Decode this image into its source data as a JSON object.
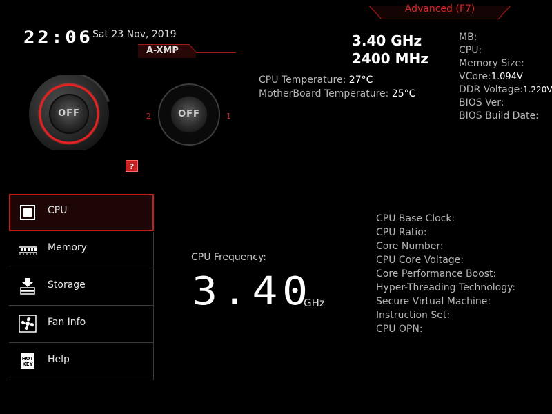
{
  "header": {
    "advanced_label": "Advanced (F7)",
    "clock": "22:06",
    "date": "Sat  23 Nov, 2019",
    "axmp_label": "A-XMP"
  },
  "knobs": {
    "game_boost_state": "OFF",
    "axmp_state": "OFF",
    "axmp_left_number": "2",
    "axmp_right_number": "1",
    "help_label": "?"
  },
  "summary": {
    "cpu_speed": "3.40 GHz",
    "memory_speed": "2400 MHz",
    "cpu_temperature_label": "CPU Temperature:",
    "cpu_temperature_value": "27°C",
    "mb_temperature_label": "MotherBoard Temperature:",
    "mb_temperature_value": "25°C"
  },
  "system_info": {
    "mb_label": "MB:",
    "cpu_label": "CPU:",
    "memory_size_label": "Memory Size:",
    "vcore_label": "VCore:",
    "vcore_value": "1.094V",
    "ddr_voltage_label": "DDR Voltage:",
    "ddr_voltage_value": "1.220V",
    "bios_ver_label": "BIOS Ver:",
    "bios_build_date_label": "BIOS Build Date:"
  },
  "sidebar": {
    "items": [
      {
        "label": "CPU",
        "icon": "cpu-icon",
        "active": true
      },
      {
        "label": "Memory",
        "icon": "memory-icon",
        "active": false
      },
      {
        "label": "Storage",
        "icon": "storage-icon",
        "active": false
      },
      {
        "label": "Fan Info",
        "icon": "fan-icon",
        "active": false
      },
      {
        "label": "Help",
        "icon": "hotkey-icon",
        "active": false
      }
    ]
  },
  "main": {
    "frequency_label": "CPU Frequency:",
    "frequency_value": "3.40",
    "frequency_unit": "GHz",
    "spec_labels": [
      "CPU Base Clock:",
      "CPU Ratio:",
      "Core Number:",
      "CPU Core Voltage:",
      "Core Performance Boost:",
      "Hyper-Threading Technology:",
      "Secure Virtual Machine:",
      "Instruction Set:",
      "CPU OPN:"
    ]
  },
  "colors": {
    "accent_red": "#c21d1d",
    "background": "#000000",
    "text_gray": "#b5b5b5"
  }
}
